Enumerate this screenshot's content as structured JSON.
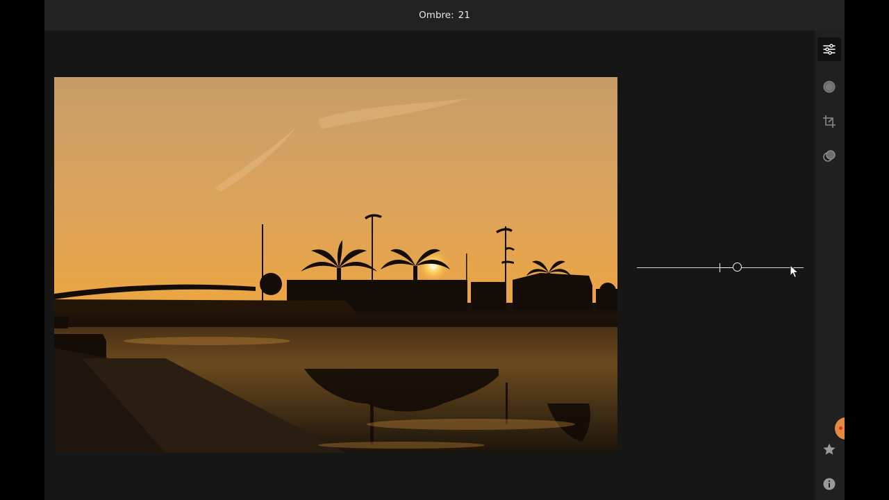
{
  "header": {
    "label": "Ombre:",
    "value": "21"
  },
  "adjustment": {
    "name": "shadows",
    "value": 21,
    "min": -100,
    "max": 100
  },
  "tools": [
    {
      "icon": "sliders-icon",
      "state": "active"
    },
    {
      "icon": "vignette-icon",
      "state": "inactive"
    },
    {
      "icon": "crop-icon",
      "state": "inactive"
    },
    {
      "icon": "filters-icon",
      "state": "inactive"
    }
  ],
  "bottom_tools": [
    {
      "icon": "star-icon"
    },
    {
      "icon": "info-icon"
    }
  ],
  "colors": {
    "background": "#161616",
    "topbar": "#222222",
    "sidebar": "#202020",
    "icon": "#8a8a8a",
    "icon_active": "#ffffff",
    "sky_top": "#c99a62",
    "sky_horizon": "#f0a93a"
  }
}
